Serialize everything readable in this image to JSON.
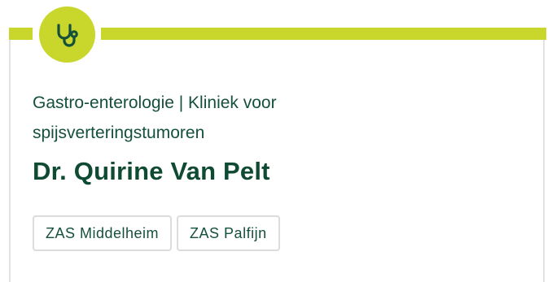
{
  "card": {
    "department": "Gastro-enterologie | Kliniek voor spijsverteringstumoren",
    "doctor_name": "Dr. Quirine Van Pelt",
    "locations": [
      "ZAS Middelheim",
      "ZAS Palfijn"
    ],
    "icon": "stethoscope-icon"
  },
  "colors": {
    "accent": "#c9d62c",
    "text": "#15503b"
  }
}
